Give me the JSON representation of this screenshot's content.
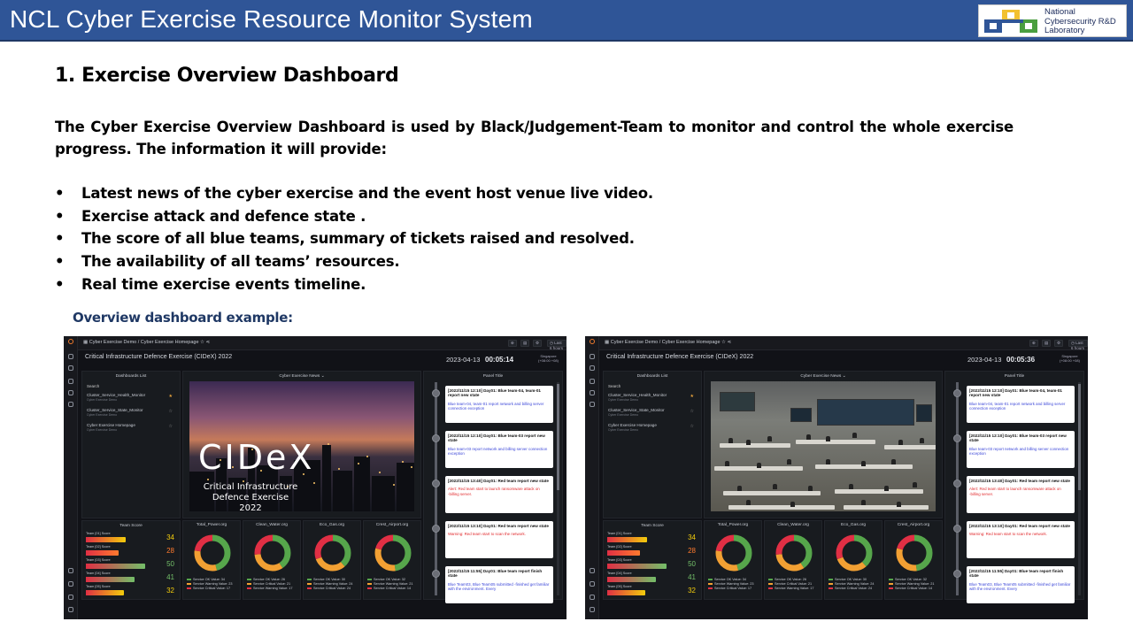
{
  "slide": {
    "title": "NCL Cyber Exercise Resource Monitor System",
    "logo": {
      "line1": "National",
      "line2": "Cybersecurity R&D",
      "line3": "Laboratory"
    },
    "heading": "1. Exercise Overview Dashboard",
    "paragraph": "The Cyber Exercise Overview Dashboard is used by Black/Judgement-Team to monitor and control the whole exercise progress. The information it will provide:",
    "bullets": [
      "Latest news of the cyber exercise and the event host venue live video.",
      "Exercise attack and defence state .",
      "The score of all blue teams, summary of tickets raised and resolved.",
      "The availability of all teams’ resources.",
      "Real time exercise events timeline."
    ],
    "caption": "Overview dashboard example:"
  },
  "dashboards": [
    {
      "breadcrumb": "Cyber Exercise Demo  /  Cyber Exercise Homepage",
      "time_range": "Last 6 hours",
      "title": "Critical Infrastructure Defence Exercise (CIDeX) 2022",
      "date": "2023-04-13",
      "clock": "00:05:14",
      "timezone_name": "Singapore",
      "timezone_offset": "(+08:00 +08)",
      "news_title": "Cyber Exercise News",
      "news_logo": "CIDeX",
      "news_subtitle_1": "Critical Infrastructure",
      "news_subtitle_2": "Defence Exercise 2022"
    },
    {
      "breadcrumb": "Cyber Exercise Demo  /  Cyber Exercise Homepage",
      "time_range": "Last 6 hours",
      "title": "Critical Infrastructure Defence Exercise (CIDeX) 2022",
      "date": "2023-04-13",
      "clock": "00:05:36",
      "timezone_name": "Singapore",
      "timezone_offset": "(+08:00 +08)",
      "news_title": "Cyber Exercise News",
      "news_logo": "",
      "news_subtitle_1": "",
      "news_subtitle_2": ""
    }
  ],
  "dash_common": {
    "list_title": "Dashboards List",
    "search_label": "Search",
    "list_items": [
      {
        "name": "Cluster_Service_Health_Monitor",
        "sub": "Cyber Exercise Demo"
      },
      {
        "name": "Cluster_Service_State_Monitor",
        "sub": "Cyber Exercise Demo"
      },
      {
        "name": "Cyber Exercise Homepage",
        "sub": "Cyber Exercise Demo"
      }
    ],
    "panel_title": "Panel Title",
    "timeline": [
      {
        "title": "[2022/11/15 12:10] Day01: Blue team-04, team-01 report new state",
        "body": "Blue team-04, team-01 report network and billing server connection exception",
        "kind": "blue"
      },
      {
        "title": "[2022/11/15 12:10] Day01: Blue team-03 report new state",
        "body": "Blue team-03 report network and billing server connection exception",
        "kind": "blue"
      },
      {
        "title": "[2022/11/15 13:40] Day01: Red team report new state",
        "body": "Alert: Red team start to launch ransomware attack on ‐billing server.",
        "kind": "red"
      },
      {
        "title": "[2022/11/15 13:10] Day01: Red team report new state",
        "body": "Warning: Red team start to scan the network.",
        "kind": "red"
      },
      {
        "title": "[2022/11/15 11:55] Day01: Blue team report finish state",
        "body": "Blue Team03, Blue Team05 submitted ‐finished get familiar with the environment. Every",
        "kind": "blue"
      }
    ],
    "score_title": "Team Score",
    "scores": [
      {
        "label": "Team [01] Score",
        "value": 34,
        "color": "#f2cc0c"
      },
      {
        "label": "Team [02] Score",
        "value": 28,
        "color": "#ff7a2e"
      },
      {
        "label": "Team [03] Score",
        "value": 50,
        "color": "#73bf69"
      },
      {
        "label": "Team [04] Score",
        "value": 41,
        "color": "#73bf69"
      },
      {
        "label": "Team [05] Score",
        "value": 32,
        "color": "#f2cc0c"
      }
    ],
    "orgs": [
      {
        "name": "Total_Power.org",
        "ok": 34,
        "warn": 23,
        "crit": 17,
        "l1": "Service OK",
        "l2": "Service Warning",
        "l3": "Service Critical"
      },
      {
        "name": "Clean_Water.org",
        "ok": 26,
        "warn": 21,
        "crit": 17,
        "l1": "Service OK",
        "l2": "Service Critical",
        "l3": "Service Warning"
      },
      {
        "name": "Eco_Gas.org",
        "ok": 30,
        "warn": 24,
        "crit": 24,
        "l1": "Service OK",
        "l2": "Service Warning",
        "l3": "Service Critical"
      },
      {
        "name": "Crest_Airport.org",
        "ok": 32,
        "warn": 21,
        "crit": 14,
        "l1": "Service OK",
        "l2": "Service Warning",
        "l3": "Service Critical"
      }
    ],
    "value_label": "Value:",
    "colors": {
      "ok": "#56a64b",
      "warn": "#f2a033",
      "crit": "#e02f44",
      "bg": "#111217"
    }
  }
}
